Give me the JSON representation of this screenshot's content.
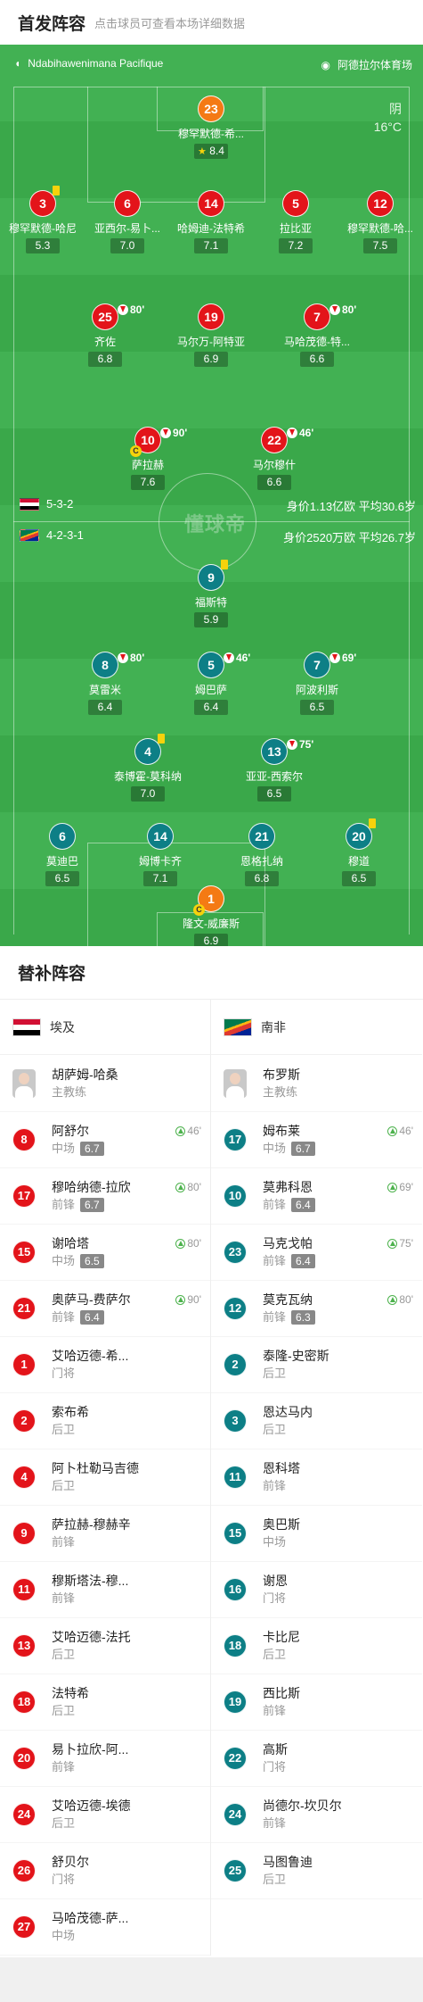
{
  "header": {
    "title": "首发阵容",
    "hint": "点击球员可查看本场详细数据"
  },
  "venue": {
    "referee": "Ndabihawenimana Pacifique",
    "stadium": "阿德拉尔体育场"
  },
  "weather": {
    "condition": "阴",
    "temperature": "16°C"
  },
  "teams": {
    "egypt": {
      "formation": "5-3-2",
      "value": "身价1.13亿欧",
      "avg_age": "平均30.6岁"
    },
    "south_africa": {
      "formation": "4-2-3-1",
      "value": "身价2520万欧",
      "avg_age": "平均26.7岁"
    }
  },
  "watermark": "懂球帝",
  "players": [
    {
      "num": "23",
      "name": "穆罕默德-希...",
      "rating": "8.4",
      "team": "orange",
      "star": true
    },
    {
      "num": "3",
      "name": "穆罕默德-哈尼",
      "rating": "5.3",
      "team": "red",
      "yellow": true
    },
    {
      "num": "6",
      "name": "亚西尔-易卜...",
      "rating": "7.0",
      "team": "red"
    },
    {
      "num": "14",
      "name": "哈姆迪-法特希",
      "rating": "7.1",
      "team": "red"
    },
    {
      "num": "5",
      "name": "拉比亚",
      "rating": "7.2",
      "team": "red"
    },
    {
      "num": "12",
      "name": "穆罕默德-哈...",
      "rating": "7.5",
      "team": "red"
    },
    {
      "num": "25",
      "name": "齐佐",
      "rating": "6.8",
      "team": "red",
      "sub": "80'"
    },
    {
      "num": "19",
      "name": "马尔万-阿特亚",
      "rating": "6.9",
      "team": "red"
    },
    {
      "num": "7",
      "name": "马哈茂德-特...",
      "rating": "6.6",
      "team": "red",
      "sub": "80'"
    },
    {
      "num": "10",
      "name": "萨拉赫",
      "rating": "7.6",
      "team": "red",
      "sub": "90'",
      "cap": true
    },
    {
      "num": "22",
      "name": "马尔穆什",
      "rating": "6.6",
      "team": "red",
      "sub": "46'"
    },
    {
      "num": "9",
      "name": "福斯特",
      "rating": "5.9",
      "team": "teal",
      "yellow": true
    },
    {
      "num": "8",
      "name": "莫雷米",
      "rating": "6.4",
      "team": "teal",
      "sub": "80'"
    },
    {
      "num": "5",
      "name": "姆巴萨",
      "rating": "6.4",
      "team": "teal",
      "sub": "46'"
    },
    {
      "num": "7",
      "name": "阿波利斯",
      "rating": "6.5",
      "team": "teal",
      "sub": "69'"
    },
    {
      "num": "4",
      "name": "泰博霍-莫科纳",
      "rating": "7.0",
      "team": "teal",
      "yellow": true
    },
    {
      "num": "13",
      "name": "亚亚-西索尔",
      "rating": "6.5",
      "team": "teal",
      "sub": "75'"
    },
    {
      "num": "6",
      "name": "莫迪巴",
      "rating": "6.5",
      "team": "teal"
    },
    {
      "num": "14",
      "name": "姆博卡齐",
      "rating": "7.1",
      "team": "teal"
    },
    {
      "num": "21",
      "name": "恩格扎纳",
      "rating": "6.8",
      "team": "teal"
    },
    {
      "num": "20",
      "name": "穆道",
      "rating": "6.5",
      "team": "teal",
      "yellow": true
    },
    {
      "num": "1",
      "name": "隆文-威廉斯",
      "rating": "6.9",
      "team": "orange",
      "cap": true
    }
  ],
  "subs": {
    "title": "替补阵容",
    "egypt": {
      "team": "埃及",
      "coach": {
        "name": "胡萨姆-哈桑",
        "role": "主教练"
      },
      "list": [
        {
          "num": "8",
          "name": "阿舒尔",
          "pos": "中场",
          "rating": "6.7",
          "time": "46'"
        },
        {
          "num": "17",
          "name": "穆哈纳德-拉欣",
          "pos": "前锋",
          "rating": "6.7",
          "time": "80'"
        },
        {
          "num": "15",
          "name": "谢哈塔",
          "pos": "中场",
          "rating": "6.5",
          "time": "80'"
        },
        {
          "num": "21",
          "name": "奥萨马-费萨尔",
          "pos": "前锋",
          "rating": "6.4",
          "time": "90'"
        },
        {
          "num": "1",
          "name": "艾哈迈德-希...",
          "pos": "门将"
        },
        {
          "num": "2",
          "name": "索布希",
          "pos": "后卫"
        },
        {
          "num": "4",
          "name": "阿卜杜勒马吉德",
          "pos": "后卫"
        },
        {
          "num": "9",
          "name": "萨拉赫-穆赫辛",
          "pos": "前锋"
        },
        {
          "num": "11",
          "name": "穆斯塔法-穆...",
          "pos": "前锋"
        },
        {
          "num": "13",
          "name": "艾哈迈德-法托",
          "pos": "后卫"
        },
        {
          "num": "18",
          "name": "法特希",
          "pos": "后卫"
        },
        {
          "num": "20",
          "name": "易卜拉欣-阿...",
          "pos": "前锋"
        },
        {
          "num": "24",
          "name": "艾哈迈德-埃德",
          "pos": "后卫"
        },
        {
          "num": "26",
          "name": "舒贝尔",
          "pos": "门将"
        },
        {
          "num": "27",
          "name": "马哈茂德-萨...",
          "pos": "中场"
        }
      ]
    },
    "south_africa": {
      "team": "南非",
      "coach": {
        "name": "布罗斯",
        "role": "主教练"
      },
      "list": [
        {
          "num": "17",
          "name": "姆布莱",
          "pos": "中场",
          "rating": "6.7",
          "time": "46'"
        },
        {
          "num": "10",
          "name": "莫弗科恩",
          "pos": "前锋",
          "rating": "6.4",
          "time": "69'"
        },
        {
          "num": "23",
          "name": "马克戈帕",
          "pos": "前锋",
          "rating": "6.4",
          "time": "75'"
        },
        {
          "num": "12",
          "name": "莫克瓦纳",
          "pos": "前锋",
          "rating": "6.3",
          "time": "80'"
        },
        {
          "num": "2",
          "name": "泰隆-史密斯",
          "pos": "后卫"
        },
        {
          "num": "3",
          "name": "恩达马内",
          "pos": "后卫"
        },
        {
          "num": "11",
          "name": "恩科塔",
          "pos": "前锋"
        },
        {
          "num": "15",
          "name": "奥巴斯",
          "pos": "中场"
        },
        {
          "num": "16",
          "name": "谢恩",
          "pos": "门将"
        },
        {
          "num": "18",
          "name": "卡比尼",
          "pos": "后卫"
        },
        {
          "num": "19",
          "name": "西比斯",
          "pos": "前锋"
        },
        {
          "num": "22",
          "name": "高斯",
          "pos": "门将"
        },
        {
          "num": "24",
          "name": "尚德尔-坎贝尔",
          "pos": "前锋"
        },
        {
          "num": "25",
          "name": "马图鲁迪",
          "pos": "后卫"
        }
      ]
    }
  }
}
